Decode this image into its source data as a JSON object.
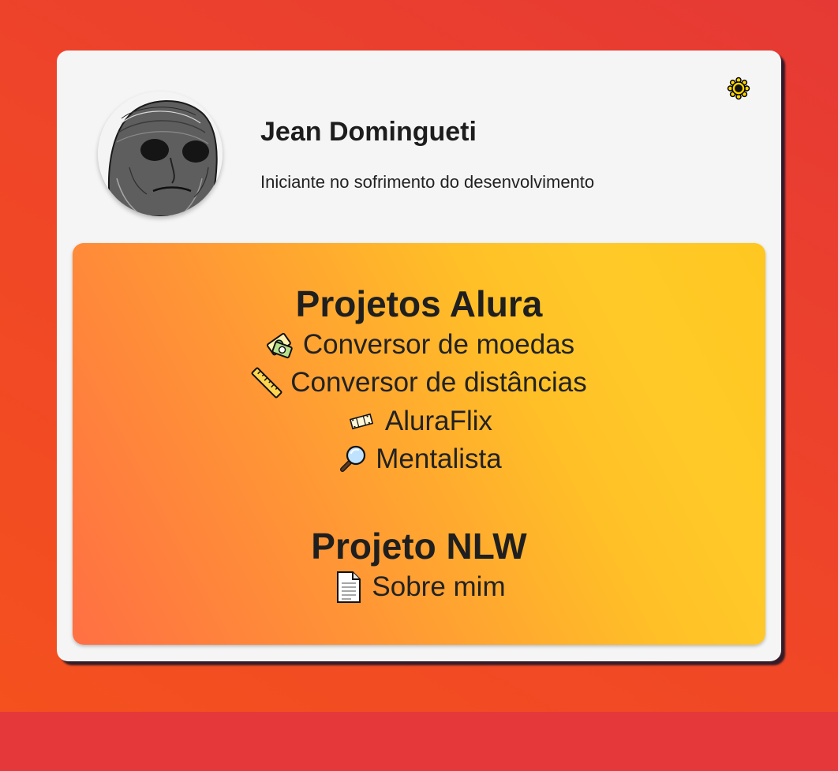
{
  "profile": {
    "name": "Jean Domingueti",
    "bio": "Iniciante no sofrimento do desenvolvimento"
  },
  "theme_toggle": {
    "icon": "sun-icon"
  },
  "sections": [
    {
      "title": "Projetos Alura",
      "projects": [
        {
          "label": "Conversor de moedas",
          "icon": "currency-exchange-icon"
        },
        {
          "label": "Conversor de distâncias",
          "icon": "ruler-icon"
        },
        {
          "label": "AluraFlix",
          "icon": "film-icon"
        },
        {
          "label": "Mentalista",
          "icon": "magnifier-icon"
        }
      ]
    },
    {
      "title": "Projeto NLW",
      "projects": [
        {
          "label": "Sobre mim",
          "icon": "document-icon"
        }
      ]
    }
  ],
  "colors": {
    "page_background": "#e53935",
    "card_background": "#f5f5f5",
    "panel_gradient_start": "#ff6f43",
    "panel_gradient_end": "#ffca28",
    "text": "#1f1f1f"
  }
}
